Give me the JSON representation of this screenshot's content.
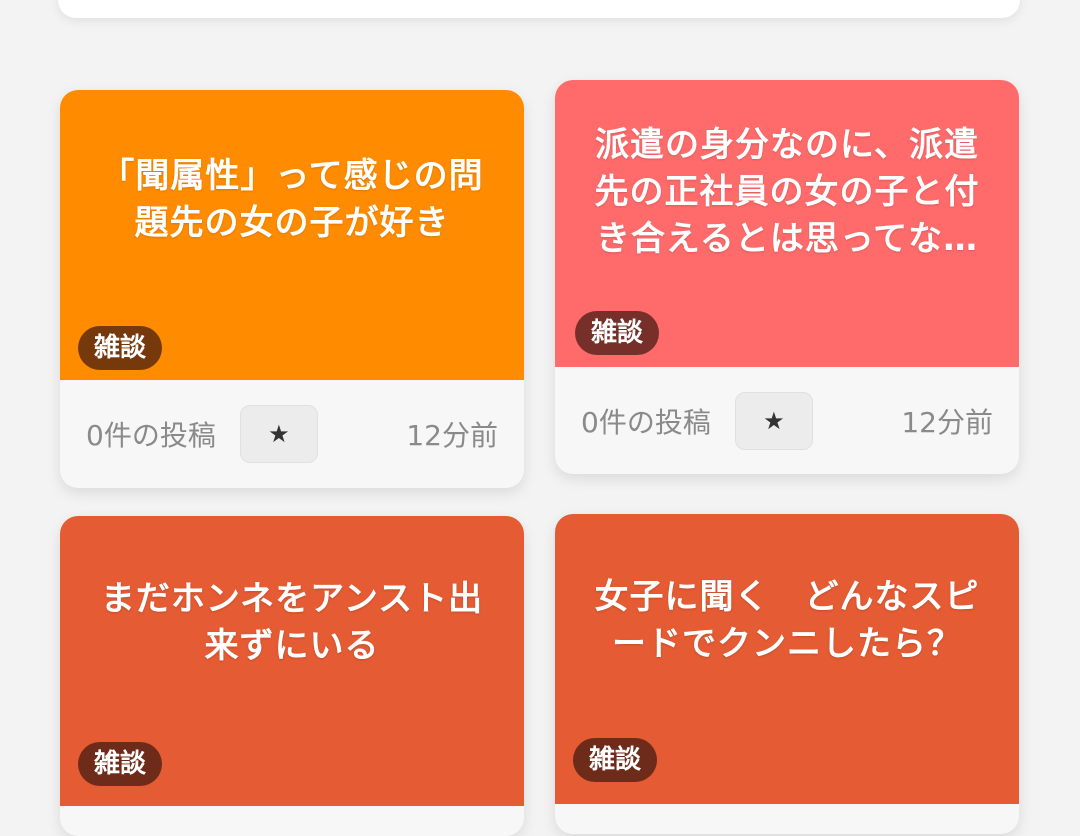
{
  "posts": [
    {
      "title": "「聞属性」って感じの問題先の女の子が好き",
      "tag": "雑談",
      "post_count": "0件の投稿",
      "star": "★",
      "time": "12分前",
      "color": "#ff8c00"
    },
    {
      "title": "派遣の身分なのに、派遣先の正社員の女の子と付き合えるとは思ってな…",
      "tag": "雑談",
      "post_count": "0件の投稿",
      "star": "★",
      "time": "12分前",
      "color": "#ff6b6b"
    },
    {
      "title": "まだホンネをアンスト出来ずにいる",
      "tag": "雑談",
      "color": "#e55b33"
    },
    {
      "title": "女子に聞く　どんなスピードでクンニしたら？",
      "tag": "雑談",
      "color": "#e55b33"
    }
  ]
}
